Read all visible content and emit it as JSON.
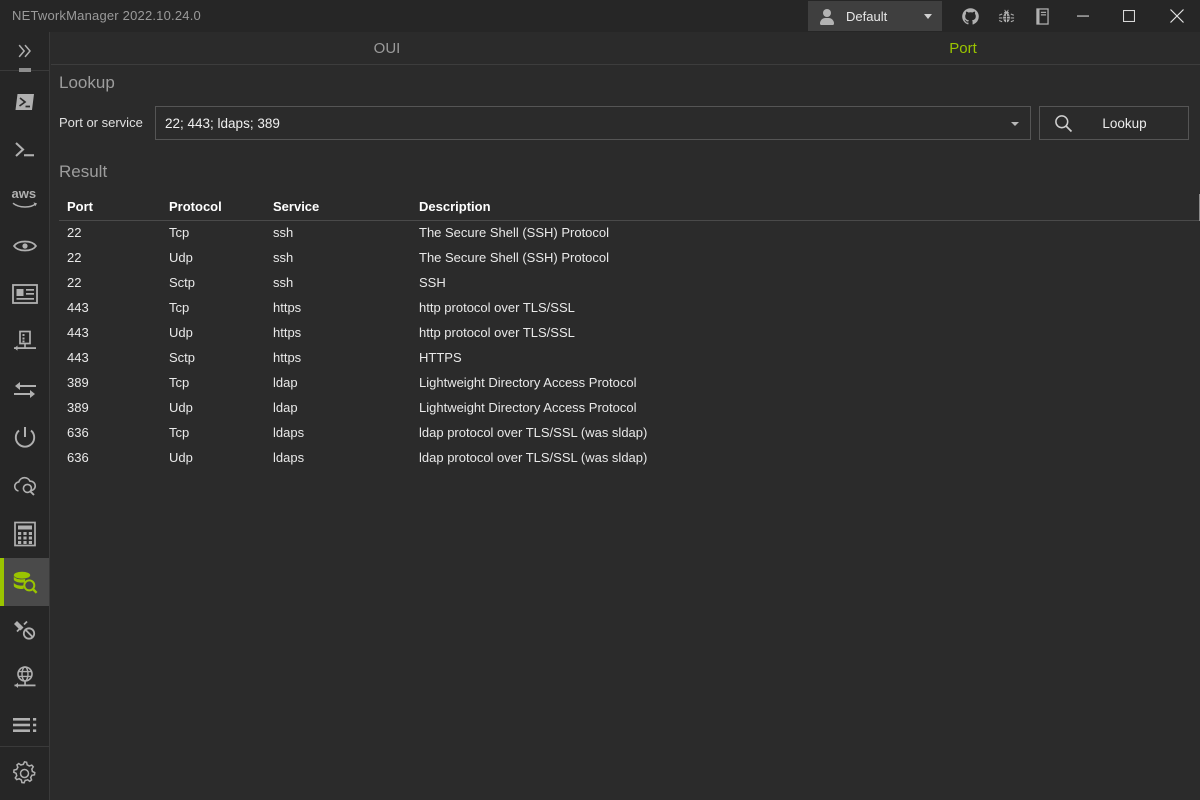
{
  "window": {
    "title": "NETworkManager 2022.10.24.0",
    "profile": {
      "name": "Default",
      "icon": "user-icon",
      "caret": "chevron-down-icon"
    },
    "titlebar_icons": [
      {
        "name": "github-icon",
        "tooltip": "GitHub"
      },
      {
        "name": "bug-icon",
        "tooltip": "Report a bug"
      },
      {
        "name": "docs-icon",
        "tooltip": "Documentation"
      }
    ],
    "controls": [
      {
        "name": "minimize-button",
        "glyph": "minimize-icon"
      },
      {
        "name": "maximize-button",
        "glyph": "maximize-icon"
      },
      {
        "name": "close-button",
        "glyph": "close-icon"
      }
    ]
  },
  "sidebar": {
    "toggle": {
      "name": "expand-sidebar-button",
      "icon": "chevron-double-right-icon"
    },
    "items": [
      {
        "name": "powershell",
        "icon": "powershell-icon",
        "active": false
      },
      {
        "name": "puttyterminal",
        "icon": "terminal-icon",
        "active": false
      },
      {
        "name": "aws-session-manager",
        "icon": "aws-icon",
        "label": "aws",
        "active": false
      },
      {
        "name": "remote-desktop",
        "icon": "eye-icon",
        "active": false
      },
      {
        "name": "tigervnc",
        "icon": "id-card-icon",
        "active": false
      },
      {
        "name": "network-interface",
        "icon": "server-network-icon",
        "active": false
      },
      {
        "name": "port-forwarding",
        "icon": "arrows-exchange-icon",
        "active": false
      },
      {
        "name": "wake-on-lan",
        "icon": "power-icon",
        "active": false
      },
      {
        "name": "dns-lookup",
        "icon": "cloud-search-icon",
        "active": false
      },
      {
        "name": "subnet-calculator",
        "icon": "calculator-icon",
        "active": false
      },
      {
        "name": "lookup",
        "icon": "database-search-icon",
        "active": true
      },
      {
        "name": "connections",
        "icon": "plug-disconnect-icon",
        "active": false
      },
      {
        "name": "whois",
        "icon": "globe-network-icon",
        "active": false
      },
      {
        "name": "listeners",
        "icon": "list-lines-icon",
        "active": false
      }
    ],
    "settings": {
      "name": "settings",
      "icon": "gear-icon"
    }
  },
  "tabs": [
    {
      "label": "OUI",
      "active": false
    },
    {
      "label": "Port",
      "active": true
    }
  ],
  "main": {
    "lookup_heading": "Lookup",
    "port_label": "Port or service",
    "port_value": "22; 443; ldaps; 389",
    "port_placeholder": "Port or service",
    "lookup_button": "Lookup",
    "search_icon": "search-icon",
    "result_heading": "Result"
  },
  "table": {
    "columns": [
      "Port",
      "Protocol",
      "Service",
      "Description"
    ],
    "rows": [
      {
        "port": "22",
        "protocol": "Tcp",
        "service": "ssh",
        "description": "The Secure Shell (SSH) Protocol"
      },
      {
        "port": "22",
        "protocol": "Udp",
        "service": "ssh",
        "description": "The Secure Shell (SSH) Protocol"
      },
      {
        "port": "22",
        "protocol": "Sctp",
        "service": "ssh",
        "description": "SSH"
      },
      {
        "port": "443",
        "protocol": "Tcp",
        "service": "https",
        "description": "http protocol over TLS/SSL"
      },
      {
        "port": "443",
        "protocol": "Udp",
        "service": "https",
        "description": "http protocol over TLS/SSL"
      },
      {
        "port": "443",
        "protocol": "Sctp",
        "service": "https",
        "description": "HTTPS"
      },
      {
        "port": "389",
        "protocol": "Tcp",
        "service": "ldap",
        "description": "Lightweight Directory Access Protocol"
      },
      {
        "port": "389",
        "protocol": "Udp",
        "service": "ldap",
        "description": "Lightweight Directory Access Protocol"
      },
      {
        "port": "636",
        "protocol": "Tcp",
        "service": "ldaps",
        "description": "ldap protocol over TLS/SSL (was sldap)"
      },
      {
        "port": "636",
        "protocol": "Udp",
        "service": "ldaps",
        "description": "ldap protocol over TLS/SSL (was sldap)"
      }
    ]
  },
  "colors": {
    "accent": "#9ac400",
    "titlebar_bg": "#262626",
    "content_bg": "#2b2b2b",
    "sidebar_bg": "#262626",
    "active_item_bg": "#4a4a4a",
    "text": "#e9e9e9",
    "muted_text": "#9a9a9a"
  }
}
